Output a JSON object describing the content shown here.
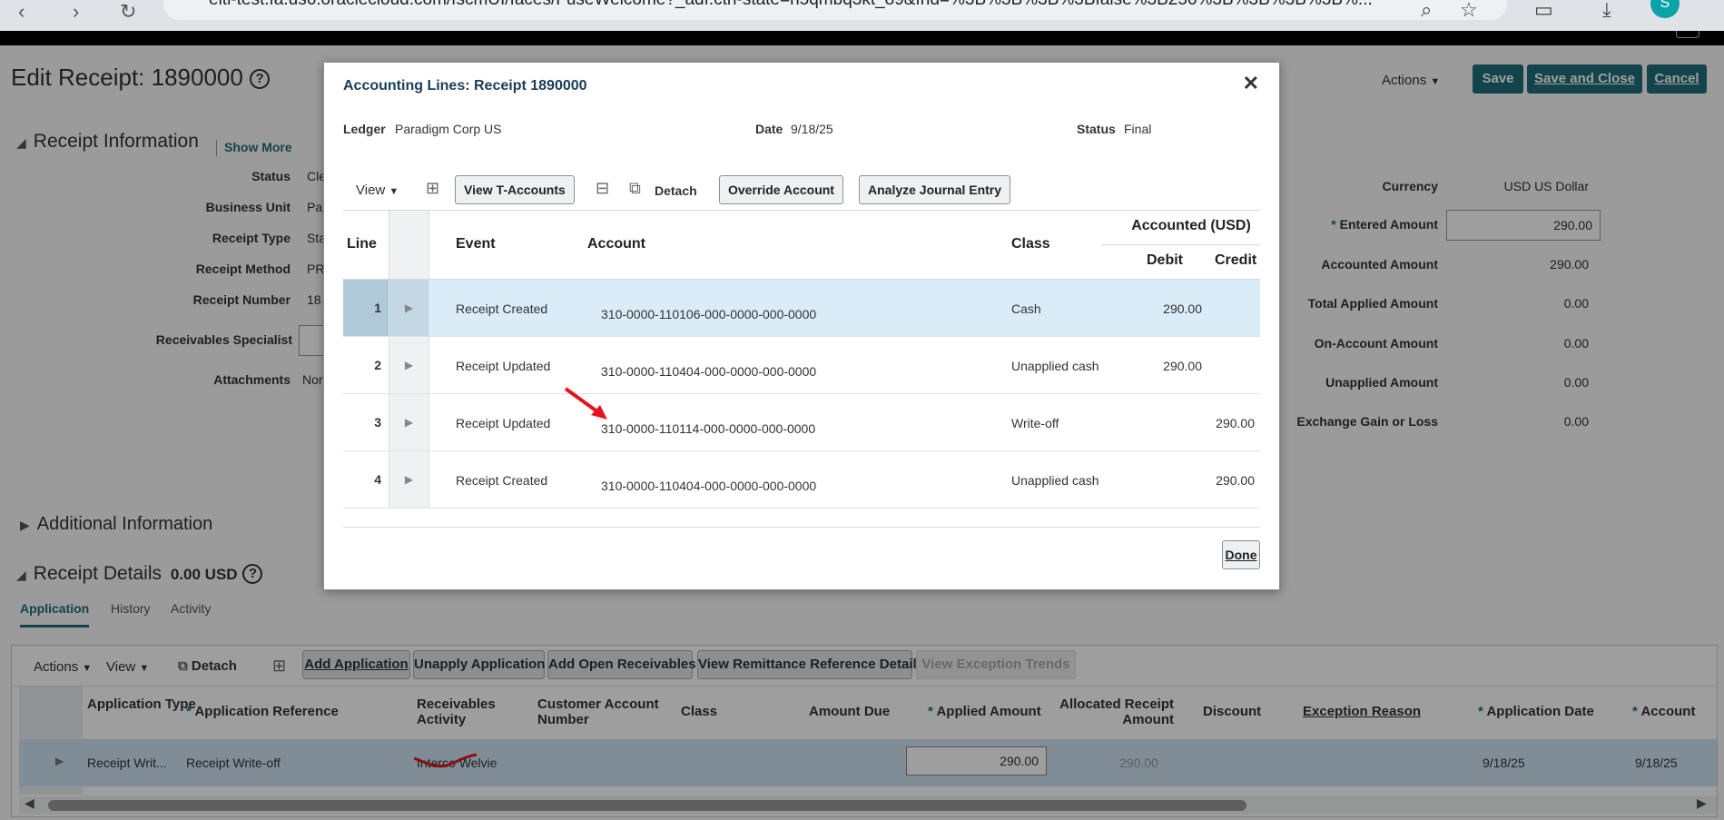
{
  "browser": {
    "url": "eiti-test.fa.us6.oraclecloud.com/fscmUI/faces/FuseWelcome?_adf.ctrl-state=n5qmbq3kt_89&fnd=%3B%3B%3B%3Bfalse%3B256%3B%3B%3B%3B%...",
    "profile_initial": "S"
  },
  "page": {
    "title": "Edit Receipt: 1890000",
    "actions_label": "Actions",
    "save_label": "Save",
    "save_close_label": "Save and Close",
    "cancel_label": "Cancel"
  },
  "receipt_info": {
    "heading": "Receipt Information",
    "show_more": "Show More",
    "fields": [
      {
        "label": "Status",
        "value": "Cle"
      },
      {
        "label": "Business Unit",
        "value": "Pa"
      },
      {
        "label": "Receipt Type",
        "value": "Sta"
      },
      {
        "label": "Receipt Method",
        "value": "PR"
      },
      {
        "label": "Receipt Number",
        "value": "18"
      },
      {
        "label": "Receivables Specialist",
        "value": ""
      },
      {
        "label": "Attachments",
        "value": "Nor"
      }
    ]
  },
  "amounts": {
    "currency_label": "Currency",
    "currency_value": "USD US Dollar",
    "entered_label": "Entered Amount",
    "entered_value": "290.00",
    "accounted_label": "Accounted Amount",
    "accounted_value": "290.00",
    "total_applied_label": "Total Applied Amount",
    "total_applied_value": "0.00",
    "on_account_label": "On-Account Amount",
    "on_account_value": "0.00",
    "unapplied_label": "Unapplied Amount",
    "unapplied_value": "0.00",
    "exchange_label": "Exchange Gain or Loss",
    "exchange_value": "0.00"
  },
  "additional_info": {
    "heading": "Additional Information"
  },
  "receipt_details": {
    "heading": "Receipt Details",
    "amount": "0.00 USD",
    "tabs": [
      "Application",
      "History",
      "Activity"
    ],
    "toolbar": {
      "actions": "Actions",
      "view": "View",
      "detach": "Detach",
      "add_application": "Add Application",
      "unapply_application": "Unapply Application",
      "add_open_receivables": "Add Open Receivables",
      "view_remittance": "View Remittance Reference Detail",
      "view_exception": "View Exception Trends"
    },
    "columns": {
      "app_type": "Application Type",
      "app_ref": "Application Reference",
      "recv_activity": "Receivables Activity",
      "cust_acct": "Customer Account Number",
      "class": "Class",
      "amount_due": "Amount Due",
      "applied": "Applied Amount",
      "allocated": "Allocated Receipt Amount",
      "discount": "Discount",
      "exception": "Exception Reason",
      "app_date": "Application Date",
      "account": "Account"
    },
    "row": {
      "app_type": "Receipt Writ...",
      "app_ref": "Receipt Write-off",
      "recv_activity": "Interco Welvie",
      "applied": "290.00",
      "allocated": "290.00",
      "app_date": "9/18/25",
      "account": "9/18/25"
    }
  },
  "dialog": {
    "title": "Accounting Lines: Receipt 1890000",
    "ledger_label": "Ledger",
    "ledger_value": "Paradigm Corp US",
    "date_label": "Date",
    "date_value": "9/18/25",
    "status_label": "Status",
    "status_value": "Final",
    "toolbar": {
      "view": "View",
      "view_t_accounts": "View T-Accounts",
      "detach": "Detach",
      "override_account": "Override Account",
      "analyze_journal": "Analyze Journal Entry"
    },
    "headers": {
      "line": "Line",
      "event": "Event",
      "account": "Account",
      "class": "Class",
      "accounted": "Accounted (USD)",
      "debit": "Debit",
      "credit": "Credit"
    },
    "rows": [
      {
        "line": "1",
        "event": "Receipt Created",
        "account": "310-0000-110106-000-0000-000-0000",
        "class": "Cash",
        "debit": "290.00",
        "credit": ""
      },
      {
        "line": "2",
        "event": "Receipt Updated",
        "account": "310-0000-110404-000-0000-000-0000",
        "class": "Unapplied cash",
        "debit": "290.00",
        "credit": ""
      },
      {
        "line": "3",
        "event": "Receipt Updated",
        "account": "310-0000-110114-000-0000-000-0000",
        "class": "Write-off",
        "debit": "",
        "credit": "290.00"
      },
      {
        "line": "4",
        "event": "Receipt Created",
        "account": "310-0000-110404-000-0000-000-0000",
        "class": "Unapplied cash",
        "debit": "",
        "credit": "290.00"
      }
    ],
    "done_label": "Done"
  },
  "colors": {
    "accent": "#1f6f7a",
    "annotation": "#e8141c",
    "selected_row": "#d9ecf8"
  }
}
